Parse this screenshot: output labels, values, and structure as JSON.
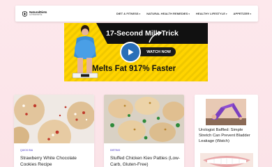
{
  "header": {
    "logo_name": "NaturalDiets",
    "logo_tagline": "AUTHORITATIVE",
    "nav": [
      {
        "label": "DIET & FITNESS",
        "chevron": "▾"
      },
      {
        "label": "NATURAL HEALTH REMEDIES",
        "chevron": "▾"
      },
      {
        "label": "HEALTHY LIFESTYLE",
        "chevron": "▾"
      },
      {
        "label": "APPETIZER",
        "chevron": "▾"
      }
    ]
  },
  "ad": {
    "headline": "17-Second Milk Trick",
    "cta": "WATCH NOW",
    "tagline": "Melts Fat 917% Faster",
    "colors": {
      "background": "#ffd400",
      "band": "#111111",
      "play": "#2a6fb8"
    }
  },
  "cards": [
    {
      "category": "QUICK BIA",
      "title": "Strawberry White Chocolate Cookies Recipe"
    },
    {
      "category": "DIETING",
      "title": "Stuffed Chicken Kiev Patties (Low-Carb, Gluten-Free)"
    },
    {
      "title": "Urologist Baffled: Simple Stretch Can Prevent Bladder Leakage (Watch)"
    }
  ]
}
